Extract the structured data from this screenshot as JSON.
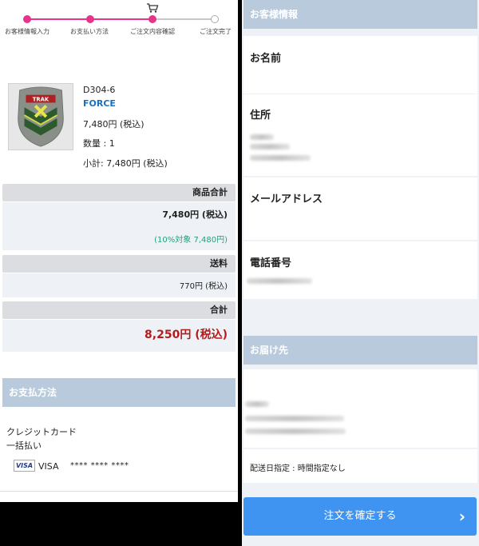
{
  "steps": [
    "お客様情報入力",
    "お支払い方法",
    "ご注文内容確認",
    "ご注文完了"
  ],
  "product": {
    "image_text": "TRAK",
    "code": "D304-6",
    "name": "FORCE",
    "price": "7,480円 (税込)",
    "quantity": "数量 :  1",
    "subtotal": "小計:   7,480円 (税込)"
  },
  "summary": {
    "items_label": "商品合計",
    "items_value": "7,480円 (税込)",
    "tax_note": "(10%対象 7,480円)",
    "shipping_label": "送料",
    "shipping_value": "770円 (税込)",
    "total_label": "合計",
    "total_value": "8,250円 (税込)"
  },
  "payment": {
    "header": "お支払方法",
    "method": "クレジットカード",
    "plan": "一括払い",
    "card_badge": "VISA",
    "card_brand": "VISA",
    "card_number": "**** **** ****"
  },
  "customer": {
    "header": "お客様情報",
    "name_label": "お名前",
    "address_label": "住所",
    "email_label": "メールアドレス",
    "phone_label": "電話番号"
  },
  "delivery": {
    "header": "お届け先",
    "date_note": "配送日指定 :  時間指定なし"
  },
  "confirm_button": "注文を確定する",
  "colors": {
    "accent": "#e8338b",
    "header": "#b9cadc",
    "total": "#b31c1c",
    "button": "#3f94f1",
    "tax_note": "#2a9d78"
  }
}
